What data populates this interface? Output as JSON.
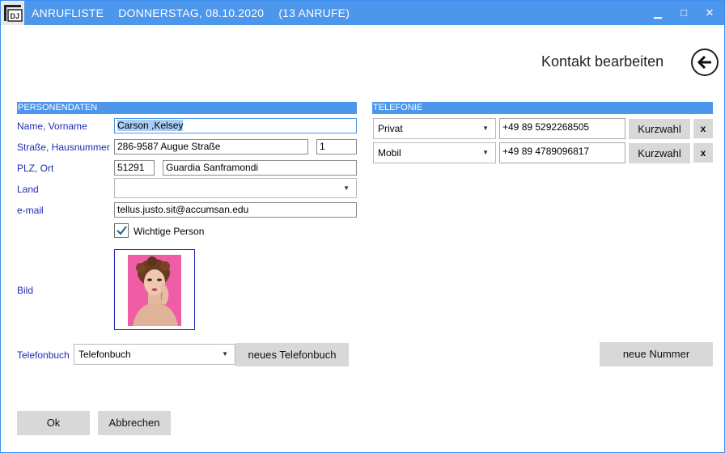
{
  "window": {
    "title": "ANRUFLISTE",
    "date": "DONNERSTAG, 08.10.2020",
    "calls": "(13 ANRUFE)",
    "logo_text": "DJ",
    "minimize_glyph": "▁",
    "maximize_glyph": "□",
    "close_glyph": "✕"
  },
  "header": {
    "title": "Kontakt bearbeiten",
    "back_icon": "arrow-left-icon"
  },
  "person": {
    "section_title": "PERSONENDATEN",
    "name_label": "Name, Vorname",
    "name_value": "Carson ,Kelsey",
    "street_label": "Straße, Hausnummer",
    "street_value": "286-9587 Augue  Straße",
    "house_number_value": "1",
    "plz_label": "PLZ, Ort",
    "plz_value": "51291",
    "city_value": "Guardia Sanframondi",
    "country_label": "Land",
    "country_value": "",
    "email_label": "e-mail",
    "email_value": "tellus.justo.sit@accumsan.edu",
    "important_label": "Wichtige Person",
    "important_checked": true,
    "picture_label": "Bild",
    "phonebook_label": "Telefonbuch",
    "phonebook_value": "Telefonbuch",
    "new_phonebook_button": "neues Telefonbuch"
  },
  "telephony": {
    "section_title": "TELEFONIE",
    "numbers": [
      {
        "type": "Privat",
        "number": "+49 89 5292268505",
        "speed_dial": "Kurzwahl",
        "delete": "x"
      },
      {
        "type": "Mobil",
        "number": "+49 89 4789096817",
        "speed_dial": "Kurzwahl",
        "delete": "x"
      }
    ],
    "new_number_button": "neue Nummer"
  },
  "footer": {
    "ok_button": "Ok",
    "cancel_button": "Abbrechen"
  },
  "colors": {
    "accent": "#4c96ec",
    "label_text": "#1c2bb0",
    "button_bg": "#d8d8d8",
    "selection": "#a9cdf5"
  }
}
